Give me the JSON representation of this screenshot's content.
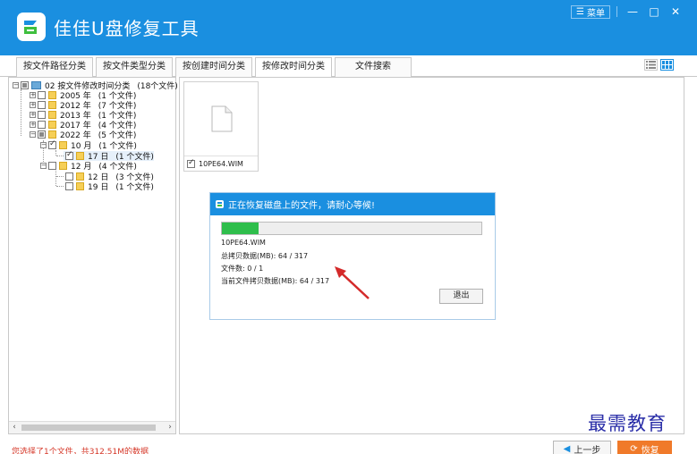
{
  "app": {
    "title": "佳佳U盘修复工具",
    "menu_label": "菜单",
    "minimize_glyph": "—",
    "maximize_glyph": "□",
    "close_glyph": "✕",
    "brand_color": "#1a8fe0"
  },
  "tabs": [
    {
      "label": "按文件路径分类"
    },
    {
      "label": "按文件类型分类"
    },
    {
      "label": "按创建时间分类"
    },
    {
      "label": "按修改时间分类",
      "active": true
    },
    {
      "label": "文件搜索"
    }
  ],
  "view_icons": [
    "list-view-icon",
    "grid-view-icon"
  ],
  "tree": {
    "root": {
      "label": "02  按文件修改时间分类",
      "count": "(18个文件)"
    },
    "years": [
      {
        "label": "2005 年",
        "count": "(1 个文件)"
      },
      {
        "label": "2012 年",
        "count": "(7 个文件)"
      },
      {
        "label": "2013 年",
        "count": "(1 个文件)"
      },
      {
        "label": "2017 年",
        "count": "(4 个文件)"
      },
      {
        "label": "2022 年",
        "count": "(5 个文件)"
      }
    ],
    "months": [
      {
        "label": "10 月",
        "count": "(1 个文件)"
      },
      {
        "label": "12 月",
        "count": "(4 个文件)"
      }
    ],
    "days": [
      {
        "label": "17 日",
        "count": "(1 个文件)"
      },
      {
        "label": "12 日",
        "count": "(3 个文件)"
      },
      {
        "label": "19 日",
        "count": "(1 个文件)"
      }
    ]
  },
  "file": {
    "name": "10PE64.WIM"
  },
  "dialog": {
    "title": "正在恢复磁盘上的文件，请耐心等候!",
    "progress_fraction": 0.14,
    "current_file": "10PE64.WIM",
    "total_copied": "总拷贝数据(MB): 64 / 317",
    "file_count": "文件数: 0 / 1",
    "current_copied": "当前文件拷贝数据(MB): 64 / 317",
    "exit_label": "退出"
  },
  "status": {
    "text": "您选择了1个文件，共312.51M的数据"
  },
  "buttons": {
    "prev_label": "上一步",
    "restore_label": "恢复",
    "restore_color": "#f07a2a"
  },
  "watermark": {
    "text": "最需教育"
  }
}
